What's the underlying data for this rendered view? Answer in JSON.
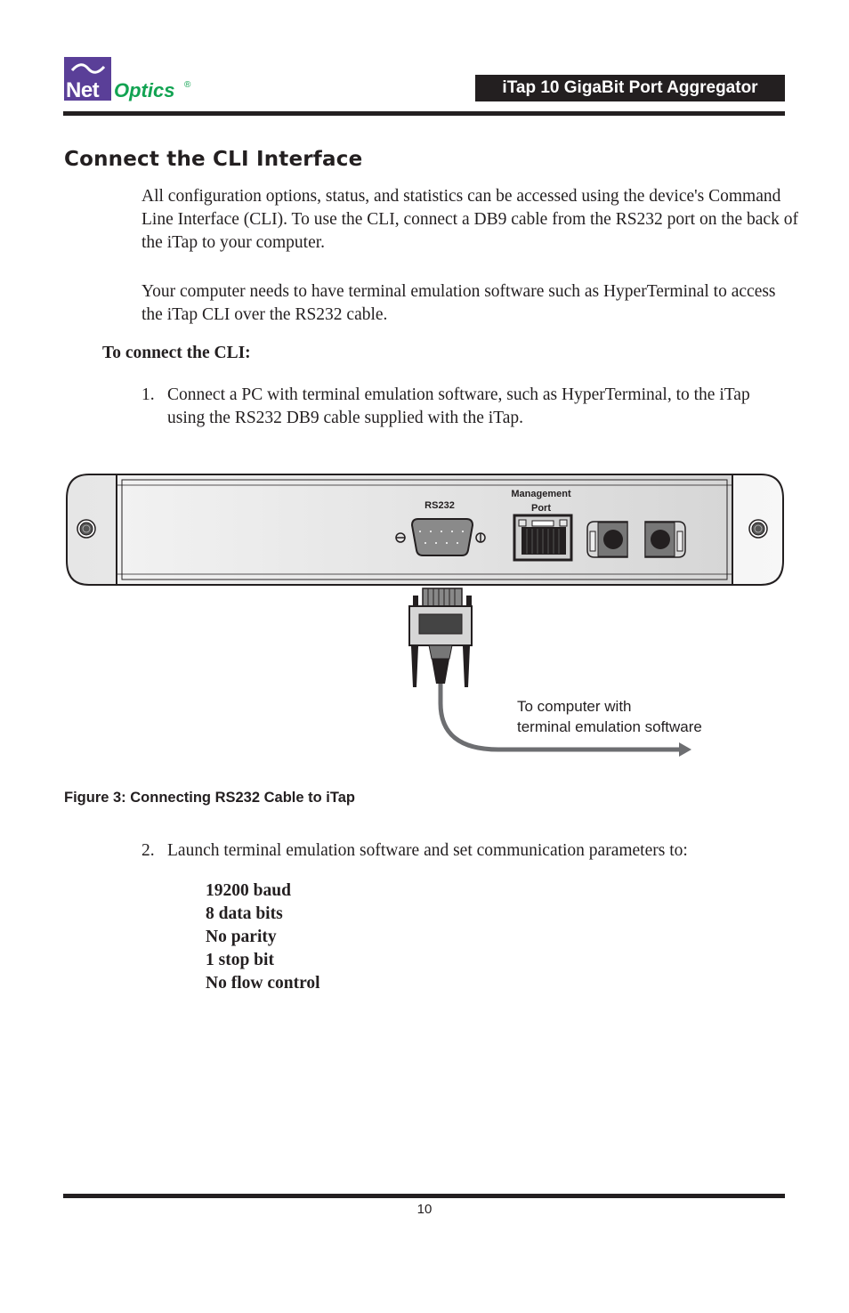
{
  "header": {
    "logo": {
      "word1": "Net",
      "word2": "Optics",
      "registered": "®",
      "icon": "wave-icon",
      "colors": {
        "box": "#5a3f98",
        "optics": "#12a352"
      }
    },
    "product_title": "iTap 10 GigaBit Port Aggregator"
  },
  "section": {
    "title": "Connect the CLI Interface",
    "paragraphs": [
      "All configuration options, status, and statistics can be accessed using the device's Command Line Interface (CLI). To use the CLI, connect a DB9 cable from the RS232 port on the back of the iTap to your computer.",
      "Your computer needs to have terminal emulation software such as HyperTerminal to access the iTap CLI over the RS232 cable."
    ],
    "procedure_heading": "To connect the CLI:",
    "steps": [
      {
        "number": "1.",
        "text": "Connect a PC with terminal emulation software, such as HyperTerminal, to the iTap using the RS232 DB9 cable supplied with the iTap."
      },
      {
        "number": "2.",
        "text": "Launch terminal emulation software and set communication parameters to:"
      }
    ],
    "parameters": [
      "19200 baud",
      "8 data bits",
      "No parity",
      "1 stop bit",
      "No flow control"
    ]
  },
  "figure": {
    "labels": {
      "rs232": "RS232",
      "management_line1": "Management",
      "management_line2": "Port",
      "computer_line1": "To computer with",
      "computer_line2": "terminal emulation software"
    },
    "caption": "Figure 3: Connecting RS232 Cable to iTap"
  },
  "footer": {
    "page_number": "10"
  }
}
